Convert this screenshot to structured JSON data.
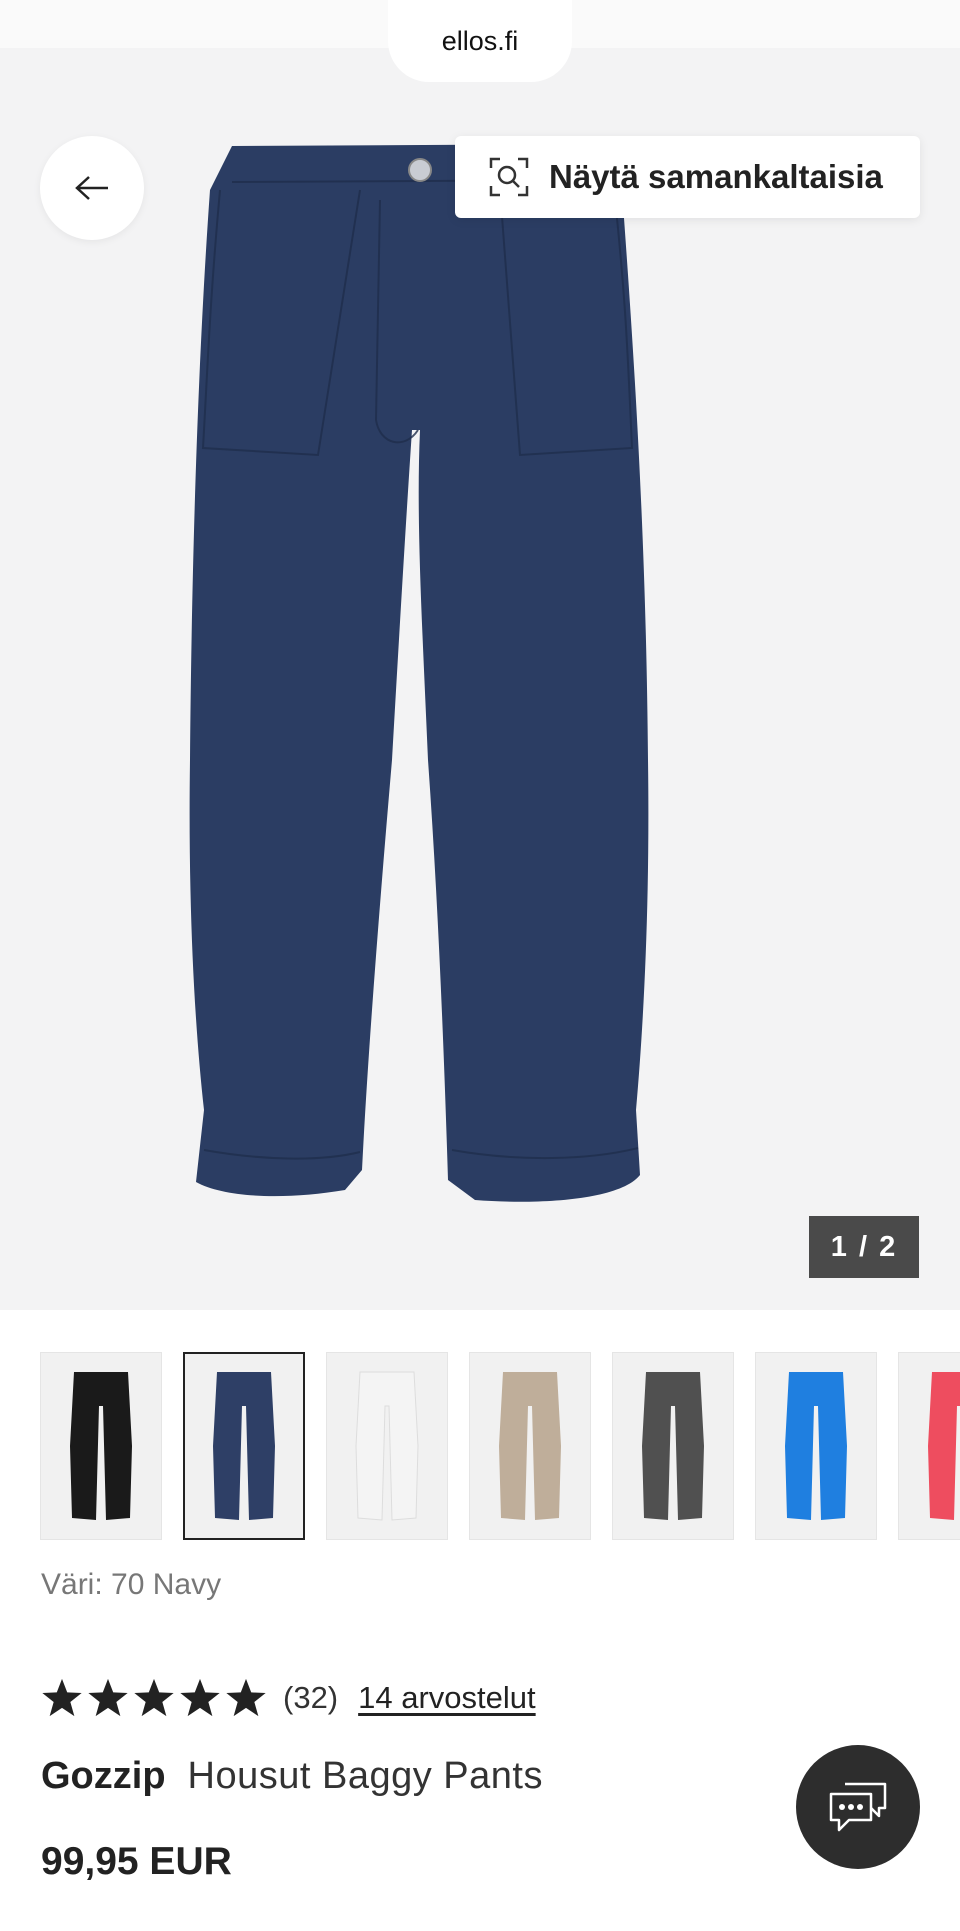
{
  "browser": {
    "url": "ellos.fi"
  },
  "hero": {
    "similar_button_label": "Näytä samankaltaisia",
    "image_counter": "1 / 2",
    "product_color": "#2b3d63"
  },
  "thumbnails": [
    {
      "name": "black",
      "color": "#1a1a1a",
      "selected": false
    },
    {
      "name": "navy",
      "color": "#2e3f66",
      "selected": true
    },
    {
      "name": "white",
      "color": "#f4f4f4",
      "selected": false
    },
    {
      "name": "beige",
      "color": "#bfae9a",
      "selected": false
    },
    {
      "name": "grey",
      "color": "#505050",
      "selected": false
    },
    {
      "name": "blue",
      "color": "#1f7fe0",
      "selected": false
    },
    {
      "name": "red",
      "color": "#ee4d5f",
      "selected": false
    }
  ],
  "product": {
    "color_label": "Väri: 70 Navy",
    "rating": {
      "stars": 5,
      "count": "(32)",
      "reviews_link": "14 arvostelut"
    },
    "brand": "Gozzip",
    "name": "Housut Baggy Pants",
    "price": "99,95 EUR"
  }
}
